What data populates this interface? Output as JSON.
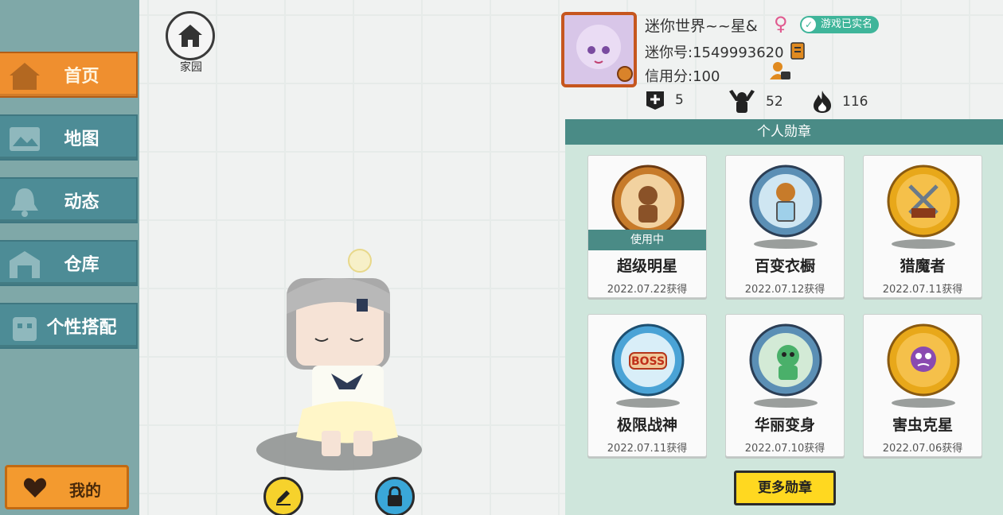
{
  "sidebar": {
    "items": [
      {
        "label": "首页",
        "icon": "house-icon",
        "active": true
      },
      {
        "label": "地图",
        "icon": "map-icon",
        "active": false
      },
      {
        "label": "动态",
        "icon": "bell-icon",
        "active": false
      },
      {
        "label": "仓库",
        "icon": "warehouse-icon",
        "active": false
      },
      {
        "label": "个性搭配",
        "icon": "outfit-icon",
        "active": false
      }
    ],
    "mine_label": "我的"
  },
  "home": {
    "label": "家园"
  },
  "profile": {
    "username": "迷你世界~~星&",
    "gender": "♀",
    "verified_label": "游戏已实名",
    "mini_id": "迷你号:1549993620",
    "credit": "信用分:100",
    "stats": {
      "friends": "5",
      "fans": "52",
      "popularity": "116"
    }
  },
  "medals": {
    "header": "个人勋章",
    "in_use_label": "使用中",
    "items": [
      {
        "name": "超级明星",
        "date": "2022.07.22获得",
        "in_use": true,
        "color": "#c77b2a"
      },
      {
        "name": "百变衣橱",
        "date": "2022.07.12获得",
        "in_use": false,
        "color": "#5b8fb5"
      },
      {
        "name": "猎魔者",
        "date": "2022.07.11获得",
        "in_use": false,
        "color": "#e8a81a"
      },
      {
        "name": "极限战神",
        "date": "2022.07.11获得",
        "in_use": false,
        "color": "#4aa3d6"
      },
      {
        "name": "华丽变身",
        "date": "2022.07.10获得",
        "in_use": false,
        "color": "#5b8fb5"
      },
      {
        "name": "害虫克星",
        "date": "2022.07.06获得",
        "in_use": false,
        "color": "#e8a81a"
      }
    ],
    "more_label": "更多勋章"
  },
  "colors": {
    "accent_orange": "#ef8f2f",
    "nav_teal": "#4d8c96",
    "panel_green": "#cfe6dc"
  }
}
